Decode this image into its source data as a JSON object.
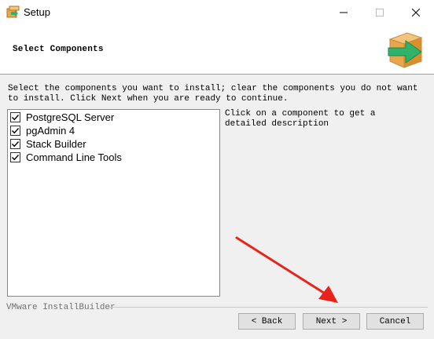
{
  "window": {
    "title": "Setup"
  },
  "header": {
    "title": "Select Components",
    "icon": "installer-package-icon"
  },
  "description": "Select the components you want to install; clear the components you do not want to install. Click Next when you are ready to continue.",
  "components": [
    {
      "label": "PostgreSQL Server",
      "checked": true
    },
    {
      "label": "pgAdmin 4",
      "checked": true
    },
    {
      "label": "Stack Builder",
      "checked": true
    },
    {
      "label": "Command Line Tools",
      "checked": true
    }
  ],
  "hint": "Click on a component to get a detailed description",
  "footer": {
    "brand": "VMware InstallBuilder",
    "back_label": "< Back",
    "next_label": "Next >",
    "cancel_label": "Cancel"
  },
  "colors": {
    "arrow_annotation": "#e8231b",
    "icon_green": "#2fb36a",
    "icon_box": "#e9a64a"
  }
}
